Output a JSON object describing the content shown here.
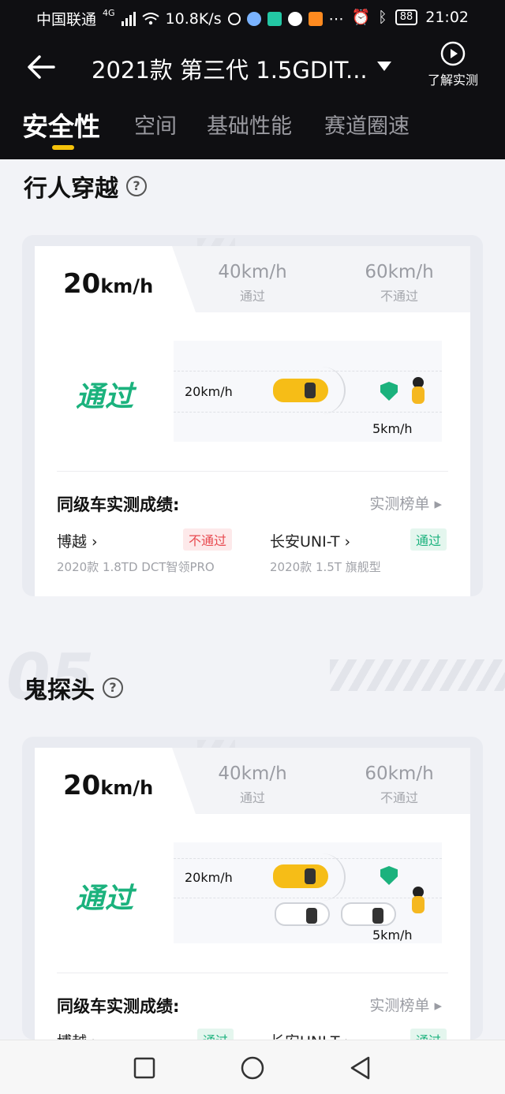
{
  "status_bar": {
    "carrier": "中国联通",
    "network": "4G",
    "speed": "10.8K/s",
    "battery": "88",
    "time": "21:02"
  },
  "header": {
    "title": "2021款 第三代 1.5GDIT...",
    "learn_label": "了解实测"
  },
  "tabs": [
    {
      "label": "安全性",
      "active": true
    },
    {
      "label": "空间",
      "active": false
    },
    {
      "label": "基础性能",
      "active": false
    },
    {
      "label": "赛道圈速",
      "active": false
    }
  ],
  "sections": [
    {
      "title": "行人穿越",
      "speed_selected": "20",
      "speed_unit": "km/h",
      "options": [
        {
          "value": "40km/h",
          "status": "通过"
        },
        {
          "value": "60km/h",
          "status": "不通过"
        }
      ],
      "result": "通过",
      "car_speed": "20km/h",
      "ped_speed": "5km/h",
      "peer_title": "同级车实测成绩:",
      "rank_link": "实测榜单",
      "peers": [
        {
          "name": "博越",
          "badge": "不通过",
          "sub": "2020款 1.8TD DCT智领PRO"
        },
        {
          "name": "长安UNI-T",
          "badge": "通过",
          "sub": "2020款 1.5T 旗舰型"
        }
      ]
    },
    {
      "title": "鬼探头",
      "bg_number": "05",
      "speed_selected": "20",
      "speed_unit": "km/h",
      "options": [
        {
          "value": "40km/h",
          "status": "通过"
        },
        {
          "value": "60km/h",
          "status": "不通过"
        }
      ],
      "result": "通过",
      "car_speed": "20km/h",
      "ped_speed": "5km/h",
      "peer_title": "同级车实测成绩:",
      "rank_link": "实测榜单",
      "peers": [
        {
          "name": "博越",
          "badge": "通过"
        },
        {
          "name": "长安UNI-T",
          "badge": "通过"
        }
      ]
    }
  ],
  "colors": {
    "accent": "#f5c20a",
    "pass": "#1bb27d",
    "fail": "#e84a50",
    "header_bg": "#0f0f12"
  }
}
